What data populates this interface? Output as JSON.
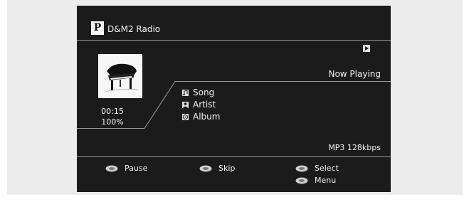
{
  "header": {
    "logo_letter": "P",
    "station": "D&M2 Radio"
  },
  "status": {
    "now_playing": "Now Playing",
    "icon": "play-icon"
  },
  "playback": {
    "time": "00:15",
    "buffer": "100%",
    "artwork": "grand-piano-image"
  },
  "track": {
    "song_label": "Song",
    "artist_label": "Artist",
    "album_label": "Album"
  },
  "format": "MP3 128kbps",
  "controls": {
    "pause": "Pause",
    "skip": "Skip",
    "select": "Select",
    "menu": "Menu"
  },
  "colors": {
    "screen_bg": "#1b1b1b",
    "text": "#f2f2f2",
    "panel_bg": "#ececec",
    "lines": "#9a9a9a"
  }
}
